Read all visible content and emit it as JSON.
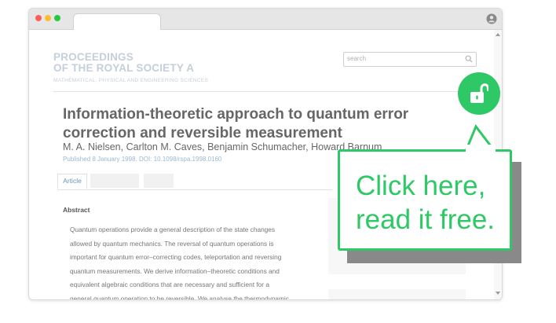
{
  "browser": {
    "window_controls": [
      "close",
      "minimize",
      "maximize"
    ],
    "profile_icon": "user-icon"
  },
  "journal": {
    "name_line1": "PROCEEDINGS",
    "name_line2": "OF THE ROYAL SOCIETY A",
    "subtitle": "MATHEMATICAL, PHYSICAL AND ENGINEERING SCIENCES"
  },
  "search": {
    "placeholder": "search",
    "icon": "search-icon"
  },
  "article": {
    "title": "Information-theoretic approach to quantum error correction and reversible measurement",
    "authors": "M. A. Nielsen, Carlton M. Caves, Benjamin Schumacher, Howard Barnum",
    "published": "Published 8 January 1998. DOI: 10.1098/rspa.1998.0160",
    "tabs": [
      {
        "label": "Article"
      },
      {
        "label": ""
      },
      {
        "label": ""
      }
    ],
    "abstract_heading": "Abstract",
    "abstract_lines": [
      "Quantum operations provide a general description of the state changes",
      "allowed by quantum mechanics. The reversal of quantum operations is",
      "important for quantum error–correcting codes, teleportation and reversing",
      "quantum measurements. We derive information–theoretic conditions and",
      "equivalent algebraic conditions that are necessary and sufficient for a",
      "general quantum operation to be reversible. We analyse the thermodynamic"
    ]
  },
  "callout": {
    "line1": "Click here,",
    "line2": "read it free.",
    "badge_icon": "unlocked-padlock-icon",
    "accent_color": "#2ec866"
  }
}
